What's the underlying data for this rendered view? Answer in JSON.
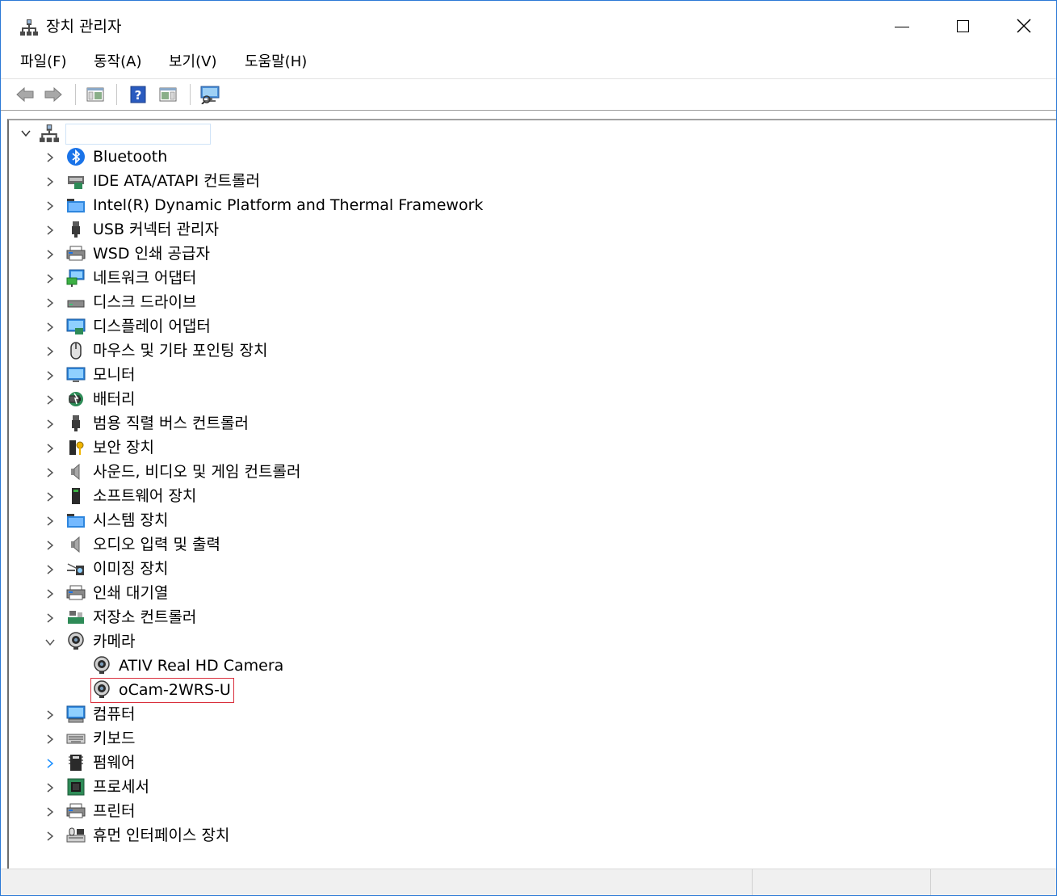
{
  "window": {
    "title": "장치 관리자"
  },
  "menu": [
    "파일(F)",
    "동작(A)",
    "보기(V)",
    "도움말(H)"
  ],
  "toolbar": {
    "buttons": [
      "back-icon",
      "forward-icon",
      "show-hide-console-tree-icon",
      "help-icon",
      "show-hide-action-pane-icon",
      "scan-hardware-icon"
    ]
  },
  "tree": {
    "root_label": "",
    "categories": [
      {
        "label": "Bluetooth",
        "icon": "bluetooth-icon",
        "expanded": false
      },
      {
        "label": "IDE ATA/ATAPI 컨트롤러",
        "icon": "ide-controller-icon",
        "expanded": false
      },
      {
        "label": "Intel(R) Dynamic Platform and Thermal Framework",
        "icon": "system-folder-icon",
        "expanded": false
      },
      {
        "label": "USB 커넥터 관리자",
        "icon": "usb-icon",
        "expanded": false
      },
      {
        "label": "WSD 인쇄 공급자",
        "icon": "printer-icon",
        "expanded": false
      },
      {
        "label": "네트워크 어댑터",
        "icon": "network-adapter-icon",
        "expanded": false
      },
      {
        "label": "디스크 드라이브",
        "icon": "disk-drive-icon",
        "expanded": false
      },
      {
        "label": "디스플레이 어댑터",
        "icon": "display-adapter-icon",
        "expanded": false
      },
      {
        "label": "마우스 및 기타 포인팅 장치",
        "icon": "mouse-icon",
        "expanded": false
      },
      {
        "label": "모니터",
        "icon": "monitor-icon",
        "expanded": false
      },
      {
        "label": "배터리",
        "icon": "battery-icon",
        "expanded": false
      },
      {
        "label": "범용 직렬 버스 컨트롤러",
        "icon": "usb-controller-icon",
        "expanded": false
      },
      {
        "label": "보안 장치",
        "icon": "security-device-icon",
        "expanded": false
      },
      {
        "label": "사운드, 비디오 및 게임 컨트롤러",
        "icon": "speaker-icon",
        "expanded": false
      },
      {
        "label": "소프트웨어 장치",
        "icon": "software-device-icon",
        "expanded": false
      },
      {
        "label": "시스템 장치",
        "icon": "system-folder-icon",
        "expanded": false
      },
      {
        "label": "오디오 입력 및 출력",
        "icon": "speaker-icon",
        "expanded": false
      },
      {
        "label": "이미징 장치",
        "icon": "imaging-device-icon",
        "expanded": false
      },
      {
        "label": "인쇄 대기열",
        "icon": "printer-icon",
        "expanded": false
      },
      {
        "label": "저장소 컨트롤러",
        "icon": "storage-controller-icon",
        "expanded": false
      },
      {
        "label": "카메라",
        "icon": "camera-icon",
        "expanded": true,
        "children": [
          {
            "label": "ATIV Real HD Camera",
            "icon": "camera-icon",
            "highlighted": false
          },
          {
            "label": "oCam-2WRS-U",
            "icon": "camera-icon",
            "highlighted": true
          }
        ]
      },
      {
        "label": "컴퓨터",
        "icon": "computer-icon",
        "expanded": false
      },
      {
        "label": "키보드",
        "icon": "keyboard-icon",
        "expanded": false
      },
      {
        "label": "펌웨어",
        "icon": "firmware-icon",
        "expanded": false,
        "hover": true
      },
      {
        "label": "프로세서",
        "icon": "processor-icon",
        "expanded": false
      },
      {
        "label": "프린터",
        "icon": "printer-icon",
        "expanded": false
      },
      {
        "label": "휴먼 인터페이스 장치",
        "icon": "hid-icon",
        "expanded": false
      }
    ]
  },
  "colors": {
    "window_border": "#2b79d6",
    "highlight_border": "#d9303d",
    "hover_chevron": "#1e90ff"
  }
}
